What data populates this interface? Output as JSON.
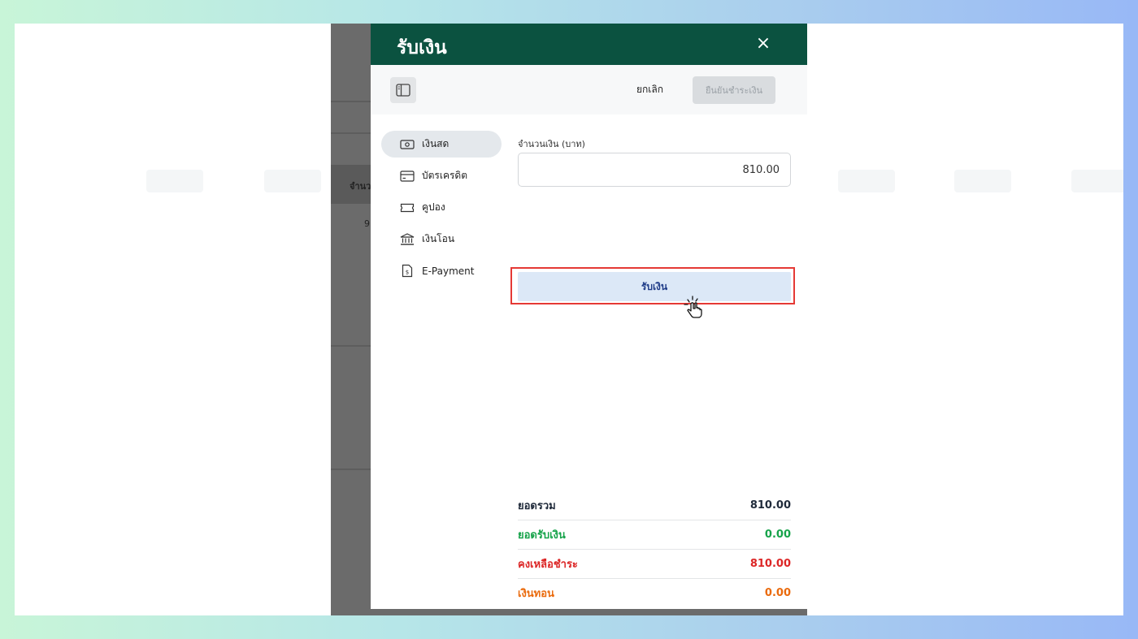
{
  "drawer": {
    "title": "รับเงิน",
    "close_icon": "×"
  },
  "toolbar": {
    "cancel_label": "ยกเลิก",
    "confirm_label": "ยืนยันชำระเงิน"
  },
  "background": {
    "column_header": "จำนว",
    "cell_value": "9"
  },
  "methods": [
    {
      "label": "เงินสด",
      "icon": "cash-icon"
    },
    {
      "label": "บัตรเครดิต",
      "icon": "credit-card-icon"
    },
    {
      "label": "คูปอง",
      "icon": "coupon-icon"
    },
    {
      "label": "เงินโอน",
      "icon": "bank-icon"
    },
    {
      "label": "E-Payment",
      "icon": "e-payment-icon"
    }
  ],
  "amount": {
    "label": "จำนวนเงิน (บาท)",
    "value": "810.00"
  },
  "receive_button": {
    "label": "รับเงิน"
  },
  "summary": {
    "total": {
      "label": "ยอดรวม",
      "value": "810.00"
    },
    "received": {
      "label": "ยอดรับเงิน",
      "value": "0.00"
    },
    "remaining": {
      "label": "คงเหลือชำระ",
      "value": "810.00"
    },
    "change": {
      "label": "เงินทอน",
      "value": "0.00"
    }
  },
  "colors": {
    "header_green": "#0b5240",
    "highlight_red": "#e53935",
    "received_green": "#16a34a",
    "remaining_red": "#dc2626",
    "change_orange": "#ea6a0c"
  }
}
